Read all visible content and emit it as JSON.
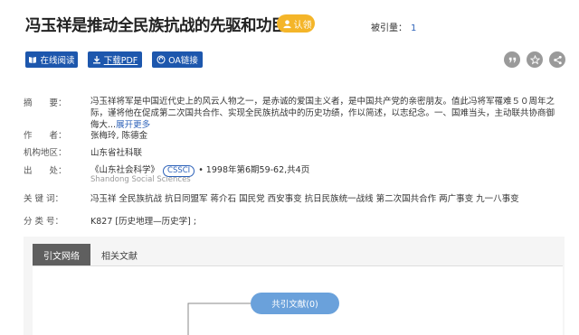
{
  "title": "冯玉祥是推动全民族抗战的先驱和功臣",
  "claim_label": "认领",
  "cited": {
    "label": "被引量：",
    "count": "1"
  },
  "actions": {
    "read_online": "在线阅读",
    "download_pdf": "下载PDF",
    "oa_link": "OA链接"
  },
  "icon_buttons": [
    "quote-icon",
    "star-icon",
    "share-icon"
  ],
  "meta": {
    "abstract_label": "摘　　要：",
    "abstract": "冯玉祥将军是中国近代史上的风云人物之一，是赤诚的爱国主义者，是中国共产党的亲密朋友。值此冯将军罹难５０周年之际，谨将他在促成第二次国共合作、实现全民族抗战中的历史功绩，作以简述，以志纪念。一、国难当头，主动联共协商御侮大...",
    "expand": "展开更多",
    "author_label": "作　　者：",
    "authors": [
      "张梅玲",
      "陈德金"
    ],
    "affiliation_label": "机构地区：",
    "affiliation": "山东省社科联",
    "source_label": "出　　处：",
    "journal": "《山东社会科学》",
    "journal_badge": "CSSCI",
    "issue": "• 1998年第6期59-62,共4页",
    "journal_en": "Shandong Social Sciences",
    "keywords_label": "关 键 词：",
    "keywords": [
      "冯玉祥",
      "全民族抗战",
      "抗日同盟军",
      "蒋介石",
      "国民党",
      "西安事变",
      "抗日民族统一战线",
      "第二次国共合作",
      "两广事变",
      "九一八事变"
    ],
    "class_label": "分 类 号：",
    "class": "K827 [历史地理—历史学] ;"
  },
  "tabs": [
    "引文网络",
    "相关文献"
  ],
  "network_node": "共引文献(0)",
  "colors": {
    "primary_button": "#1d57ad",
    "link_blue": "#2d62b9",
    "claim_badge": "#f4b529",
    "node": "#6aa1db"
  }
}
